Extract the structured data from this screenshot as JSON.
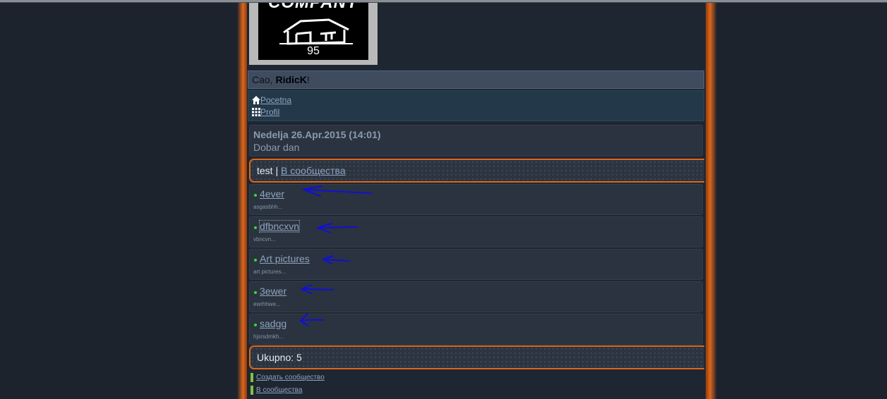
{
  "logo": {
    "text": "COMPANY",
    "number": "95"
  },
  "greeting": {
    "prefix": "Cao, ",
    "user": "RidicK",
    "suffix": "!"
  },
  "nav": [
    {
      "label": "Pocetna",
      "icon": "home-icon"
    },
    {
      "label": "Profil",
      "icon": "grid-icon"
    }
  ],
  "date_line": "Nedelja 26.Apr.2015 (14:01)",
  "welcome": "Dobar dan",
  "header": {
    "title": "test",
    "separator": " | ",
    "link": "В сообщества"
  },
  "communities": [
    {
      "name": "4ever",
      "desc": "asgasbhh..."
    },
    {
      "name": "dfbncxvn",
      "desc": "vbncvn..."
    },
    {
      "name": "Art pictures",
      "desc": "art pictures..."
    },
    {
      "name": "3ewer",
      "desc": "ewrhhwe..."
    },
    {
      "name": "sadgg",
      "desc": "hjsrsdmkh..."
    }
  ],
  "total": {
    "label": "Ukupno: ",
    "count": "5"
  },
  "footer_links": [
    "Создать сообщество",
    "В сообщества"
  ],
  "colors": {
    "accent": "#e0661a",
    "online": "#2ee02e",
    "link": "#8fa3bd",
    "annotation": "#1010d8"
  }
}
